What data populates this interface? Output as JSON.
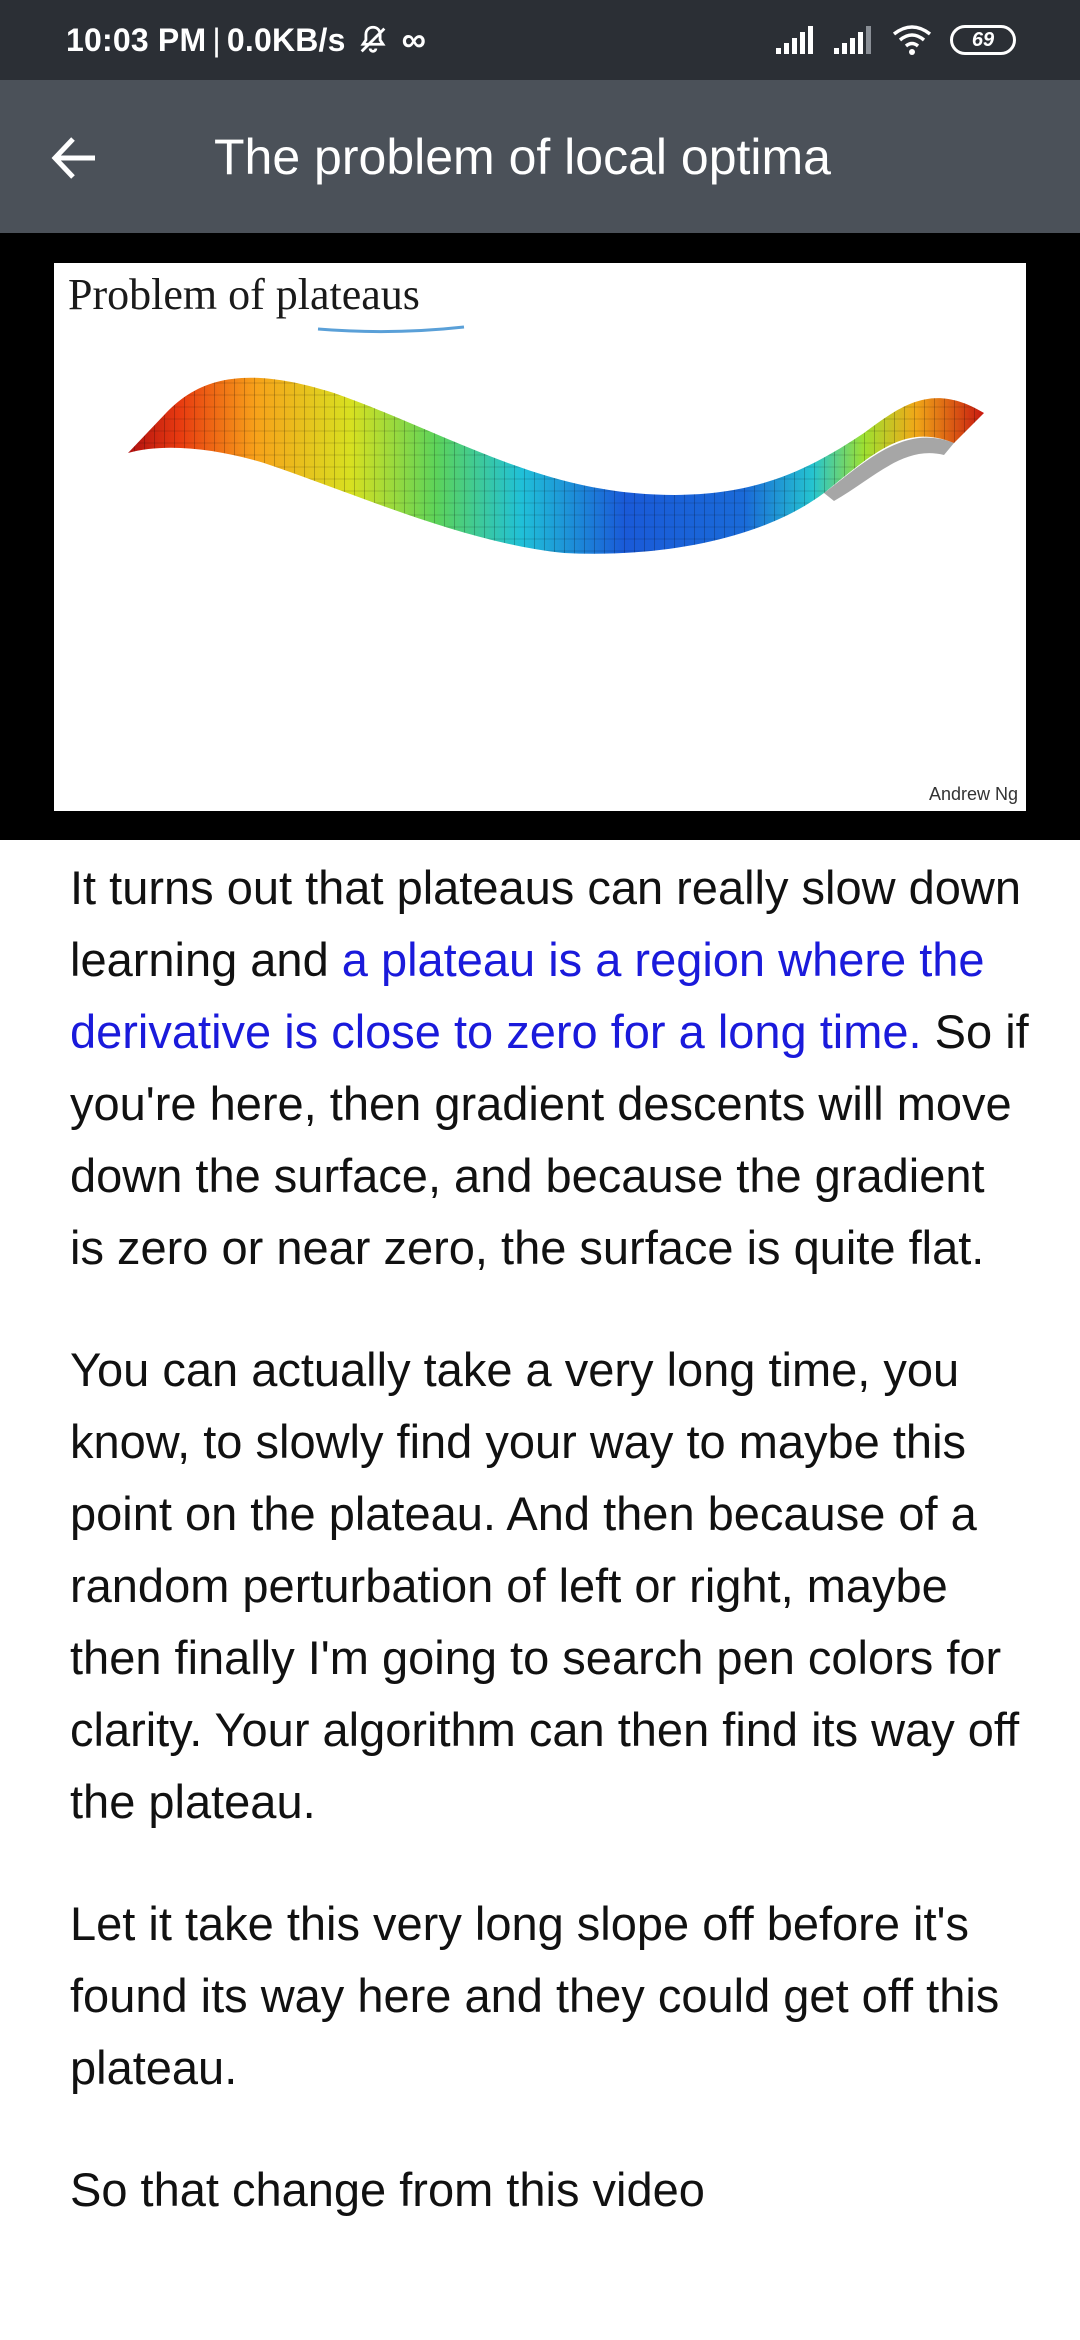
{
  "status_bar": {
    "time": "10:03 PM",
    "separator": "|",
    "network_speed": "0.0KB/s",
    "battery_level": "69",
    "icons": [
      "mute-icon",
      "infinity-icon",
      "signal-icon",
      "signal-icon-2",
      "wifi-icon",
      "battery-icon"
    ]
  },
  "app_bar": {
    "back_icon": "arrow-left-icon",
    "title": "The problem of local optima"
  },
  "slide": {
    "title": "Problem of plateaus",
    "credit": "Andrew Ng"
  },
  "transcript": {
    "p1_before": "It turns out that plateaus can really slow down learning and ",
    "p1_highlight": "a plateau is a region where the derivative is close to zero for a long time.",
    "p1_after": " So if you're here, then gradient descents will move down the surface, and because the gradient is zero or near zero, the surface is quite flat.",
    "p2": "You can actually take a very long time, you know, to slowly find your way to maybe this point on the plateau. And then because of a random perturbation of left or right, maybe then finally I'm going to search pen colors for clarity. Your algorithm can then find its way off the plateau.",
    "p3": "Let it take this very long slope off before it's found its way here and they could get off this plateau.",
    "p4_partial": "So that change from this video"
  },
  "colors": {
    "status_bar_bg": "#2b2f35",
    "app_bar_bg": "#4b5159",
    "highlight_text": "#1a1adb"
  }
}
